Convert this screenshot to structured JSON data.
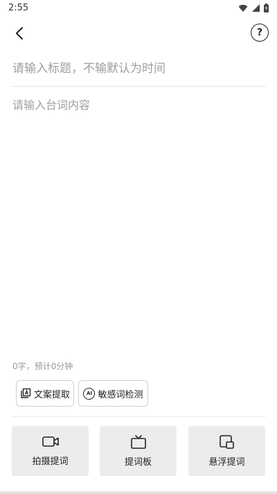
{
  "status_bar": {
    "time": "2:55",
    "icons": [
      "wifi-icon",
      "cell-signal-icon",
      "battery-icon"
    ]
  },
  "toolbar": {
    "back_icon": "chevron-left-icon",
    "help_icon": "question-circle-icon",
    "help_glyph": "?"
  },
  "editor": {
    "title_placeholder": "请输入标题，不输默认为时间",
    "title_value": "",
    "content_placeholder": "请输入台词内容",
    "content_value": "",
    "word_count": "0字，预计0分钟"
  },
  "tools": {
    "extract_label": "文案提取",
    "extract_icon": "text-extract-icon",
    "sensitive_label": "敏感词检测",
    "sensitive_icon": "ai-check-icon",
    "ai_glyph": "AI"
  },
  "actions": [
    {
      "label": "拍摄提词",
      "icon": "video-camera-icon"
    },
    {
      "label": "提词板",
      "icon": "tv-icon"
    },
    {
      "label": "悬浮提词",
      "icon": "floating-window-icon"
    }
  ]
}
